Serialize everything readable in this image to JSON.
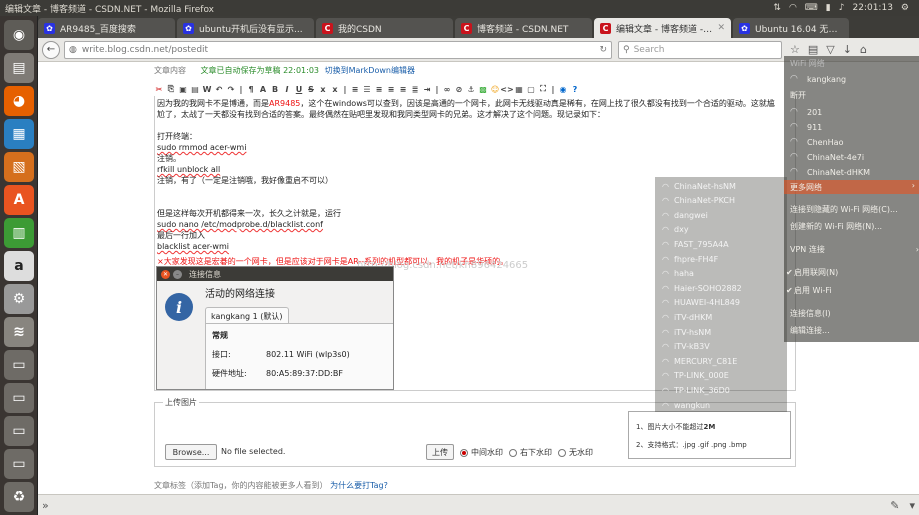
{
  "system": {
    "window_title": "编辑文章 - 博客频道 - CSDN.NET - Mozilla Firefox",
    "time": "22:01:13"
  },
  "tabs": [
    {
      "label": "AR9485_百度搜索",
      "favicon": "paw",
      "active": false
    },
    {
      "label": "ubuntu开机后没有显示...",
      "favicon": "paw",
      "active": false
    },
    {
      "label": "我的CSDN",
      "favicon": "C",
      "active": false
    },
    {
      "label": "博客频道 - CSDN.NET",
      "favicon": "C",
      "active": false
    },
    {
      "label": "编辑文章 - 博客频道 - C...",
      "favicon": "C",
      "active": true
    },
    {
      "label": "Ubuntu 16.04 无法开启...",
      "favicon": "paw",
      "active": false
    }
  ],
  "navbar": {
    "url": "write.blog.csdn.net/postedit",
    "search_placeholder": "Search"
  },
  "editor_header": {
    "content_label": "文章内容",
    "autosave": "文章已自动保存为草稿 22:01:03",
    "switch_markdown": "切换到MarkDown编辑器"
  },
  "editor": {
    "line1_prefix": "因为我的我网卡不是博通，而是",
    "line1_red": "AR9485",
    "line1_suffix": "，这个在windows可以查到，因该是高通的一个网卡，此网卡无线驱动真是稀有，在网上找了很久都没有找到一个合适的驱动。这就尴",
    "line2": "尬了，太战了一天都没有找到合适的答案。最终偶然在贴吧里发现和我同类型网卡的兄弟。这才解决了这个问题。现记录如下：",
    "cmd_open_terminal": "打开终端：",
    "cmd1": "sudo rmmod acer-wmi",
    "cmd_note1": "注销。",
    "cmd2": "rfkill unblock all",
    "cmd_note2": "注销，有了（一定是注销哦，我好像重启不可以）",
    "cmd_persist": "但是这样每次开机都得来一次，长久之计就是，运行",
    "cmd3": "sudo nano /etc/modprobe.d/blacklist.conf",
    "cmd_last_line": "最后一行加入",
    "cmd4": "blacklist acer-wmi",
    "red_note": "×大家发现这是宏碁的一个网卡，但是应该对于网卡是AR--系列的机型都可以，我的机子是华硕的。",
    "watermark": "http://blog.csdn.net/kh896424665"
  },
  "dialog": {
    "title": "连接信息",
    "heading": "活动的网络连接",
    "tab": "kangkang 1 (默认)",
    "section": "常规",
    "rows": [
      {
        "label": "接口:",
        "value": "802.11 WiFi (wlp3s0)"
      },
      {
        "label": "硬件地址:",
        "value": "80:A5:89:37:DD:BF"
      }
    ]
  },
  "upload": {
    "legend": "上传图片",
    "browse": "Browse...",
    "no_file": "No file selected.",
    "upload_button": "上传",
    "radios": [
      {
        "label": "中间水印",
        "checked": true
      },
      {
        "label": "右下水印",
        "checked": false
      },
      {
        "label": "无水印",
        "checked": false
      }
    ],
    "hint1_prefix": "1、图片大小不能超过",
    "hint1_bold": "2M",
    "hint2": "2、支持格式：.jpg .gif .png .bmp"
  },
  "tags": {
    "label": "文章标签（添加Tag，你的内容能被更多人看到）",
    "why": "为什么要打Tag?"
  },
  "netmenu": {
    "header": "WiFi 网络",
    "connected": "kangkang",
    "disconnect": "断开",
    "networks": [
      "201",
      "911",
      "ChenHao",
      "ChinaNet-4e7i",
      "ChinaNet-dHKM"
    ],
    "more": "更多网络",
    "hidden": "连接到隐藏的 Wi-Fi 网络(C)...",
    "create": "创建新的 Wi-Fi 网络(N)...",
    "vpn": "VPN 连接",
    "enable_net": "启用联网(N)",
    "enable_wifi": "启用 Wi-Fi",
    "conn_info": "连接信息(I)",
    "edit_conn": "编辑连接..."
  },
  "submenu": {
    "networks": [
      "ChinaNet-hsNM",
      "ChinaNet-PKCH",
      "dangwei",
      "dxy",
      "FAST_795A4A",
      "fhpre-FH4F",
      "haha",
      "Haier-SOHO2882",
      "HUAWEI-4HL849",
      "iTV-dHKM",
      "iTV-hsNM",
      "iTV-kB3V",
      "MERCURY_C81E",
      "TP-LINK_000E",
      "TP-LINK_36D0",
      "wangkun"
    ]
  },
  "colors": {
    "ubuntu_orange": "#e95420",
    "csdn_red": "#c9131c",
    "link_blue": "#1b5faa"
  }
}
